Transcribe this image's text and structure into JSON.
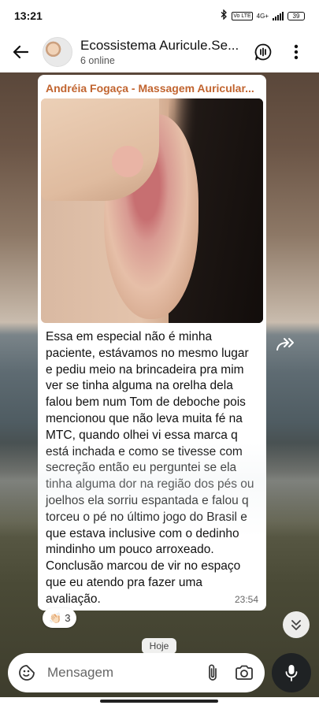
{
  "status_bar": {
    "time": "13:21",
    "network": "4G+",
    "volte": "Vo LTE",
    "battery": "39"
  },
  "header": {
    "title": "Ecossistema Auricule.Se...",
    "subtitle": "6 online",
    "back_icon": "arrow-left-icon",
    "call_icon": "group-call-icon",
    "menu_icon": "more-vertical-icon"
  },
  "message": {
    "sender": "Andréia Fogaça - Massagem Auricular...",
    "text": "Essa em especial não é minha paciente, estávamos no mesmo lugar e pediu meio na brincadeira pra mim ver se tinha alguma na orelha dela falou bem num Tom de deboche pois mencionou que não leva muita fé na MTC, quando olhei vi essa marca q está inchada e como se tivesse com secreção então eu perguntei se ela tinha alguma dor na região dos pés ou joelhos ela sorriu espantada e falou q torceu o pé no último jogo do Brasil e que estava inclusive com o dedinho mindinho um pouco arroxeado. Conclusão marcou de vir no espaço que eu atendo pra fazer uma avaliação.",
    "time": "23:54",
    "reaction_emoji": "👏🏻",
    "reaction_count": "3"
  },
  "date_chip": "Hoje",
  "input": {
    "placeholder": "Mensagem"
  },
  "colors": {
    "sender": "#c1642f",
    "mic_button": "#1f2224"
  }
}
